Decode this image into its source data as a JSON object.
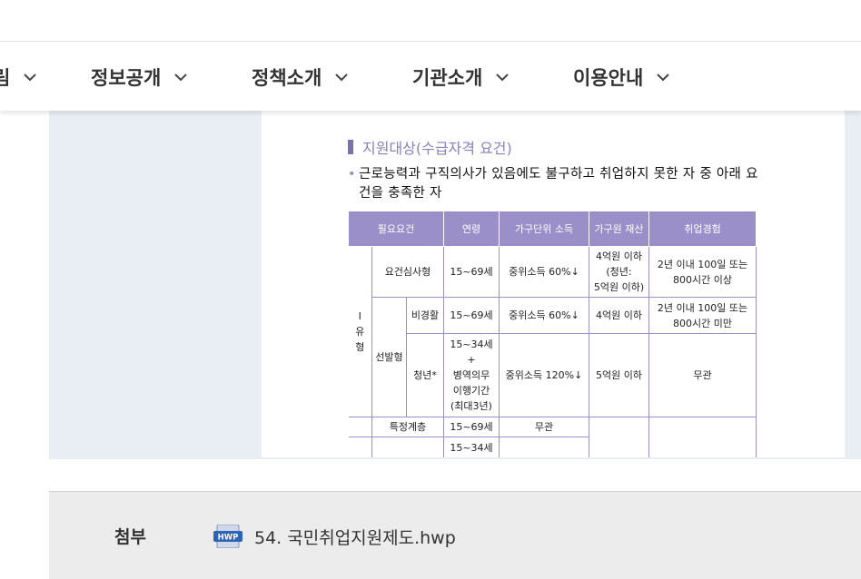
{
  "nav": {
    "partial_item": "림",
    "items": [
      {
        "label": "정보공개"
      },
      {
        "label": "정책소개"
      },
      {
        "label": "기관소개"
      },
      {
        "label": "이용안내"
      }
    ]
  },
  "doc": {
    "section_title": "지원대상(수급자격 요건)",
    "bullet": "•",
    "bullet_text": "근로능력과 구직의사가 있음에도 불구하고 취업하지 못한 자 중 아래 요건을 충족한 자",
    "table": {
      "headers": [
        "필요요건",
        "연령",
        "가구단위 소득",
        "가구원 재산",
        "취업경험"
      ],
      "type1_label": [
        "Ⅰ",
        "유",
        "형"
      ],
      "row_screening": {
        "type": "요건심사형",
        "age": "15~69세",
        "income": "중위소득 60%↓",
        "asset": [
          "4억원 이하",
          "(청년:",
          "5억원 이하)"
        ],
        "experience": [
          "2년 이내 100일 또는",
          "800시간 이상"
        ]
      },
      "selection_label": "선발형",
      "row_nonexp": {
        "type": "비경활",
        "age": "15~69세",
        "income": "중위소득 60%↓",
        "asset": "4억원 이하",
        "experience": [
          "2년 이내 100일 또는",
          "800시간 미만"
        ]
      },
      "row_youth": {
        "type": "청년*",
        "age": [
          "15~34세",
          "+",
          "병역의무",
          "이행기간",
          "(최대3년)"
        ],
        "income": "중위소득 120%↓",
        "asset": "5억원 이하",
        "experience": "무관"
      },
      "row_special": {
        "type": "특정계층",
        "age": "15~69세",
        "income": "무관"
      },
      "row_last": {
        "age": "15~34세"
      }
    }
  },
  "footer": {
    "attach_label": "첨부",
    "hwp_icon_text": "HWP",
    "file_name": "54. 국민취업지원제도.hwp"
  }
}
